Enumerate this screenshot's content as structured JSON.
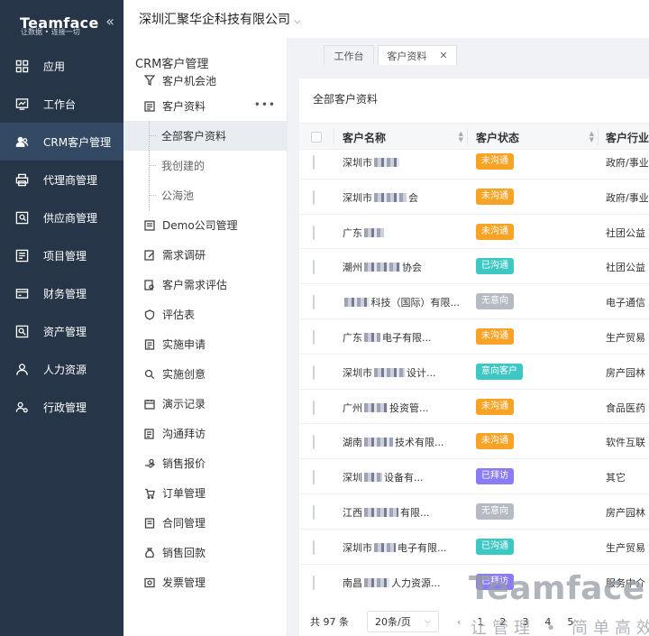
{
  "brand": {
    "logo": "Teamface",
    "slogan": "让数据 • 连接一切"
  },
  "nav": [
    {
      "label": "应用",
      "icon": "grid-icon"
    },
    {
      "label": "工作台",
      "icon": "dashboard-icon"
    },
    {
      "label": "CRM客户管理",
      "icon": "users-icon",
      "active": true
    },
    {
      "label": "代理商管理",
      "icon": "printer-icon"
    },
    {
      "label": "供应商管理",
      "icon": "supplier-icon"
    },
    {
      "label": "项目管理",
      "icon": "project-icon"
    },
    {
      "label": "财务管理",
      "icon": "finance-icon"
    },
    {
      "label": "资产管理",
      "icon": "asset-icon"
    },
    {
      "label": "人力资源",
      "icon": "person-icon"
    },
    {
      "label": "行政管理",
      "icon": "admin-icon"
    }
  ],
  "topbar": {
    "company": "深圳汇聚华企科技有限公司"
  },
  "sub": {
    "title": "CRM客户管理",
    "items": [
      {
        "label": "客户机会池"
      },
      {
        "label": "客户资料"
      },
      {
        "label": "全部客户资料"
      },
      {
        "label": "我创建的"
      },
      {
        "label": "公海池"
      },
      {
        "label": "Demo公司管理"
      },
      {
        "label": "需求调研"
      },
      {
        "label": "客户需求评估"
      },
      {
        "label": "评估表"
      },
      {
        "label": "实施申请"
      },
      {
        "label": "实施创意"
      },
      {
        "label": "演示记录"
      },
      {
        "label": "沟通拜访"
      },
      {
        "label": "销售报价"
      },
      {
        "label": "订单管理"
      },
      {
        "label": "合同管理"
      },
      {
        "label": "销售回款"
      },
      {
        "label": "发票管理"
      }
    ]
  },
  "tabs": [
    {
      "label": "工作台"
    },
    {
      "label": "客户资料"
    }
  ],
  "card": {
    "title": "全部客户资料"
  },
  "table": {
    "headers": [
      "客户名称",
      "客户状态",
      "客户行业"
    ],
    "rows": [
      {
        "pre": "深圳市",
        "post": "",
        "status": "未沟通",
        "industry": "政府/事业"
      },
      {
        "pre": "深圳市",
        "post": "会",
        "status": "未沟通",
        "industry": "政府/事业"
      },
      {
        "pre": "广东",
        "post": "",
        "status": "未沟通",
        "industry": "社团公益"
      },
      {
        "pre": "潮州",
        "post": "协会",
        "status": "已沟通",
        "industry": "社团公益"
      },
      {
        "pre": "",
        "post": "科技（国际）有限...",
        "status": "无意向",
        "industry": "电子通信"
      },
      {
        "pre": "广东",
        "post": "电子有限...",
        "status": "未沟通",
        "industry": "生产贸易"
      },
      {
        "pre": "深圳市",
        "post": "设计...",
        "status": "意向客户",
        "industry": "房产园林"
      },
      {
        "pre": "广州",
        "post": "投资管...",
        "status": "未沟通",
        "industry": "食品医药"
      },
      {
        "pre": "湖南",
        "post": "技术有限...",
        "status": "未沟通",
        "industry": "软件互联"
      },
      {
        "pre": "深圳",
        "post": "设备有...",
        "status": "已拜访",
        "industry": "其它"
      },
      {
        "pre": "江西",
        "post": "有限...",
        "status": "无意向",
        "industry": "房产园林"
      },
      {
        "pre": "深圳市",
        "post": "电子有限...",
        "status": "已沟通",
        "industry": "生产贸易"
      },
      {
        "pre": "南昌",
        "post": "人力资源...",
        "status": "已拜访",
        "industry": "服务中介"
      }
    ]
  },
  "status_colors": {
    "未沟通": "#f7a325",
    "已沟通": "#3ec8c4",
    "无意向": "#b6bac2",
    "意向客户": "#3ec8c4",
    "已拜访": "#8b7cf6"
  },
  "pager": {
    "total": "共 97 条",
    "size": "20条/页",
    "pages": [
      "1",
      "2",
      "3",
      "4",
      "5"
    ]
  },
  "watermark": {
    "big": "Teamface",
    "small": "让管理 • 简单高效"
  }
}
